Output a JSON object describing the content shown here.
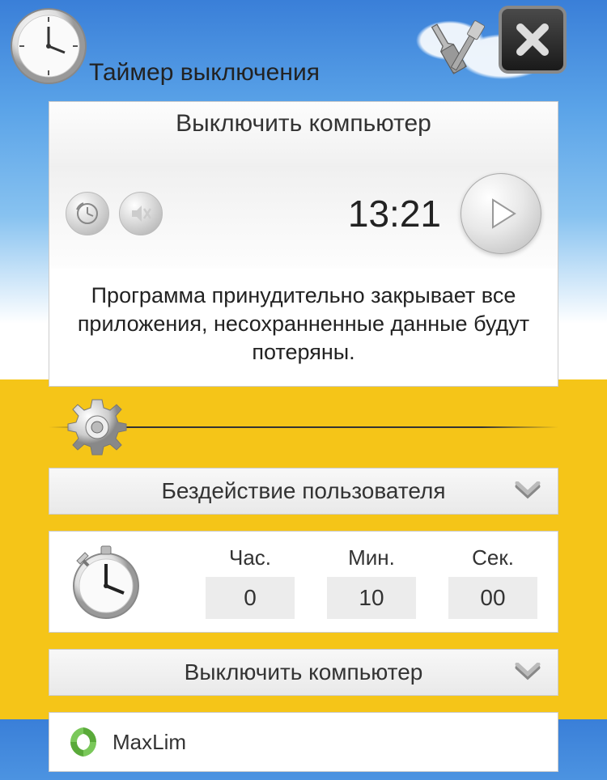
{
  "header": {
    "title": "Таймер выключения"
  },
  "action": {
    "label": "Выключить компьютер",
    "time": "13:21",
    "warning": "Программа принудительно закрывает все приложения, несохранненные данные будут потеряны."
  },
  "condition": {
    "label": "Бездействие пользователя",
    "columns": {
      "hours_label": "Час.",
      "minutes_label": "Мин.",
      "seconds_label": "Сек.",
      "hours_value": "0",
      "minutes_value": "10",
      "seconds_value": "00"
    }
  },
  "task": {
    "label": "Выключить компьютер"
  },
  "footer": {
    "brand": "MaxLim"
  }
}
